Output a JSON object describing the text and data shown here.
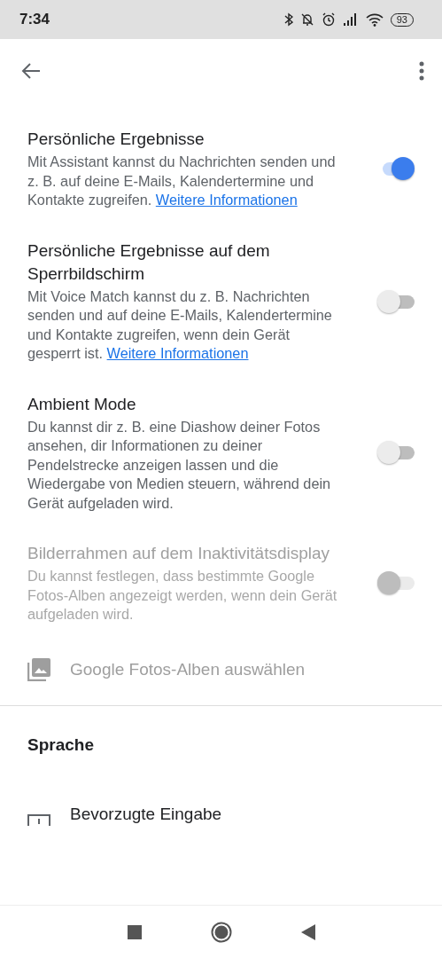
{
  "status_bar": {
    "time": "7:34",
    "battery": "93"
  },
  "settings": [
    {
      "title": "Persönliche Ergebnisse",
      "description": "Mit Assistant kannst du Nachrichten senden und z. B. auf deine E-Mails, Kalendertermine und Kontakte zugreifen.",
      "link": "Weitere Informationen",
      "on": true,
      "disabled": false
    },
    {
      "title": "Persönliche Ergebnisse auf dem Sperrbildschirm",
      "description": "Mit Voice Match kannst du z. B. Nachrichten senden und auf deine E-Mails, Kalendertermine und Kontakte zugreifen, wenn dein Gerät gesperrt ist.",
      "link": "Weitere Informationen",
      "on": false,
      "disabled": false
    },
    {
      "title": "Ambient Mode",
      "description": "Du kannst dir z. B. eine Diashow deiner Fotos ansehen, dir Informationen zu deiner Pendelstrecke anzeigen lassen und die Wiedergabe von Medien steuern, während dein Gerät aufgeladen wird.",
      "on": false,
      "disabled": false
    },
    {
      "title": "Bilderrahmen auf dem Inaktivitätsdisplay",
      "description": "Du kannst festlegen, dass bestimmte Google Fotos-Alben angezeigt werden, wenn dein Gerät aufgeladen wird.",
      "on": false,
      "disabled": true
    }
  ],
  "album_action": {
    "label": "Google Fotos-Alben auswählen",
    "disabled": true
  },
  "section": {
    "title": "Sprache"
  },
  "language_item": {
    "label": "Bevorzugte Eingabe"
  }
}
